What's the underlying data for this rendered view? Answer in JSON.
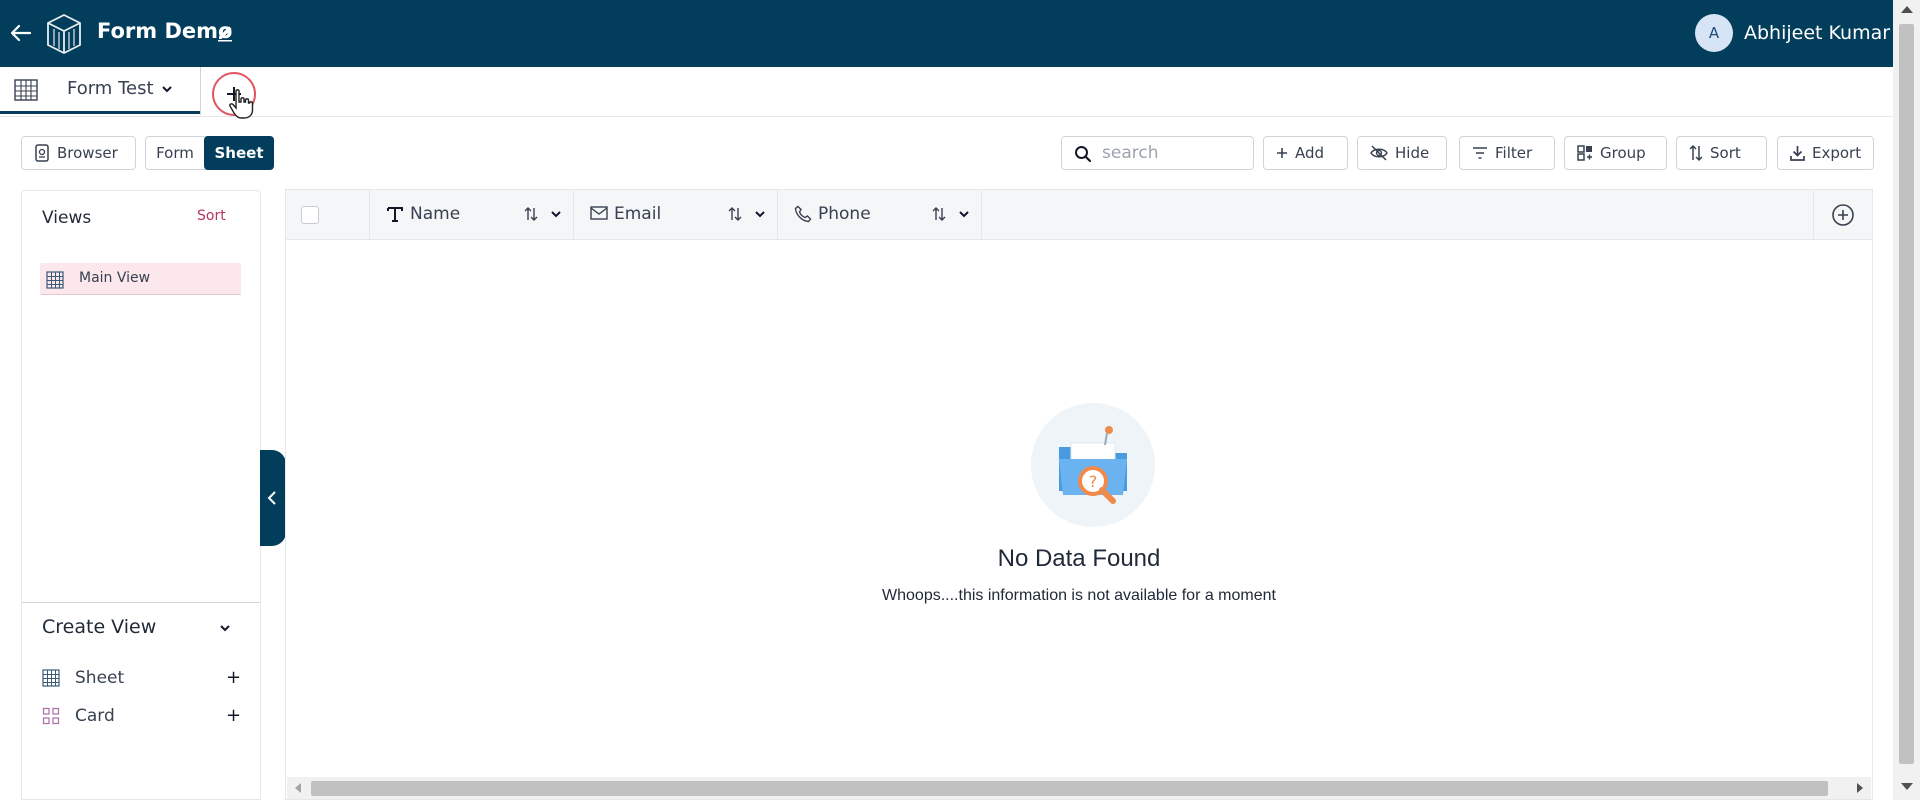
{
  "header": {
    "title": "Form Demo",
    "user": {
      "initial": "A",
      "name": "Abhijeet Kumar"
    },
    "colors": {
      "primary": "#023d5b",
      "accent": "#b2375a"
    }
  },
  "tabs": [
    {
      "label": "Form Test",
      "icon": "table-icon",
      "active": true
    }
  ],
  "toolbar": {
    "browser_label": "Browser",
    "mode_form_label": "Form",
    "mode_sheet_label": "Sheet",
    "search_placeholder": "search",
    "add_label": "Add",
    "hide_label": "Hide",
    "filter_label": "Filter",
    "group_label": "Group",
    "sort_label": "Sort",
    "export_label": "Export"
  },
  "views_panel": {
    "title": "Views",
    "sort_label": "Sort",
    "items": [
      {
        "label": "Main View",
        "icon": "table-icon"
      }
    ],
    "create_view": {
      "title": "Create View",
      "options": [
        {
          "label": "Sheet",
          "icon": "table-icon",
          "add": "+"
        },
        {
          "label": "Card",
          "icon": "card-grid-icon",
          "add": "+"
        }
      ]
    }
  },
  "grid": {
    "columns": [
      {
        "label": "Name",
        "icon": "text-type-icon"
      },
      {
        "label": "Email",
        "icon": "mail-icon"
      },
      {
        "label": "Phone",
        "icon": "phone-icon"
      }
    ],
    "rows": [],
    "empty_state": {
      "title": "No Data Found",
      "message": "Whoops....this information is not available for a moment"
    }
  }
}
